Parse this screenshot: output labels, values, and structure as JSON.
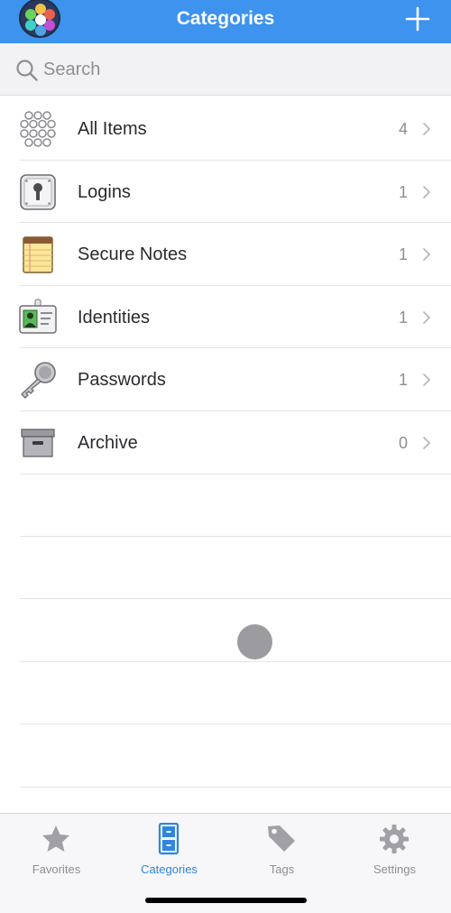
{
  "navbar": {
    "title": "Categories",
    "logo_icon": "app-logo-icon",
    "add_icon": "plus-icon",
    "bg_color": "#3d93ee"
  },
  "search": {
    "placeholder": "Search",
    "value": "",
    "icon": "search-icon"
  },
  "categories": [
    {
      "label": "All Items",
      "count": "4",
      "icon": "all-items-icon"
    },
    {
      "label": "Logins",
      "count": "1",
      "icon": "login-keyhole-icon"
    },
    {
      "label": "Secure Notes",
      "count": "1",
      "icon": "notepad-icon"
    },
    {
      "label": "Identities",
      "count": "1",
      "icon": "id-card-icon"
    },
    {
      "label": "Passwords",
      "count": "1",
      "icon": "key-icon"
    },
    {
      "label": "Archive",
      "count": "0",
      "icon": "archive-box-icon"
    }
  ],
  "tabbar": {
    "tabs": [
      {
        "label": "Favorites",
        "icon": "star-icon",
        "active": false
      },
      {
        "label": "Categories",
        "icon": "file-cabinet-icon",
        "active": true
      },
      {
        "label": "Tags",
        "icon": "tag-icon",
        "active": false
      },
      {
        "label": "Settings",
        "icon": "gear-icon",
        "active": false
      }
    ],
    "active_color": "#2f86e0",
    "inactive_color": "#8e8e93"
  }
}
